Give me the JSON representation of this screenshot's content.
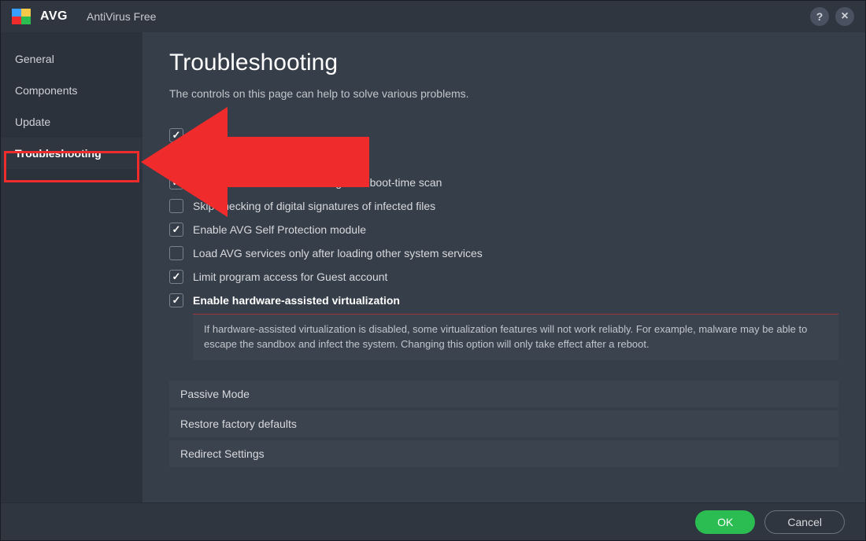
{
  "app": {
    "short": "AVG",
    "title": "AntiVirus Free"
  },
  "sidebar": {
    "items": [
      {
        "label": "General"
      },
      {
        "label": "Components"
      },
      {
        "label": "Update"
      },
      {
        "label": "Troubleshooting",
        "active": true
      }
    ]
  },
  "page": {
    "title": "Troubleshooting",
    "description": "The controls on this page can help to solve various problems."
  },
  "checks": {
    "c0": {
      "label": "",
      "checked": true
    },
    "c1": {
      "label": "",
      "checked": false
    },
    "c2": {
      "label": "Enable raw disk access during AVG boot-time scan",
      "checked": true
    },
    "c3": {
      "label": "Skip checking of digital signatures of infected files",
      "checked": false
    },
    "c4": {
      "label": "Enable AVG Self Protection module",
      "checked": true
    },
    "c5": {
      "label": "Load AVG services only after loading other system services",
      "checked": false
    },
    "c6": {
      "label": "Limit program access for Guest account",
      "checked": true
    },
    "c7": {
      "label": "Enable hardware-assisted virtualization",
      "checked": true
    }
  },
  "info": "If hardware-assisted virtualization is disabled, some virtualization features will not work reliably. For example, malware may be able to escape the sandbox and infect the system. Changing this option will only take effect after a reboot.",
  "expanders": {
    "e0": "Passive Mode",
    "e1": "Restore factory defaults",
    "e2": "Redirect Settings"
  },
  "footer": {
    "ok": "OK",
    "cancel": "Cancel"
  },
  "colors": {
    "accent_green": "#2bbd52",
    "annotation_red": "#ef2b2c"
  }
}
